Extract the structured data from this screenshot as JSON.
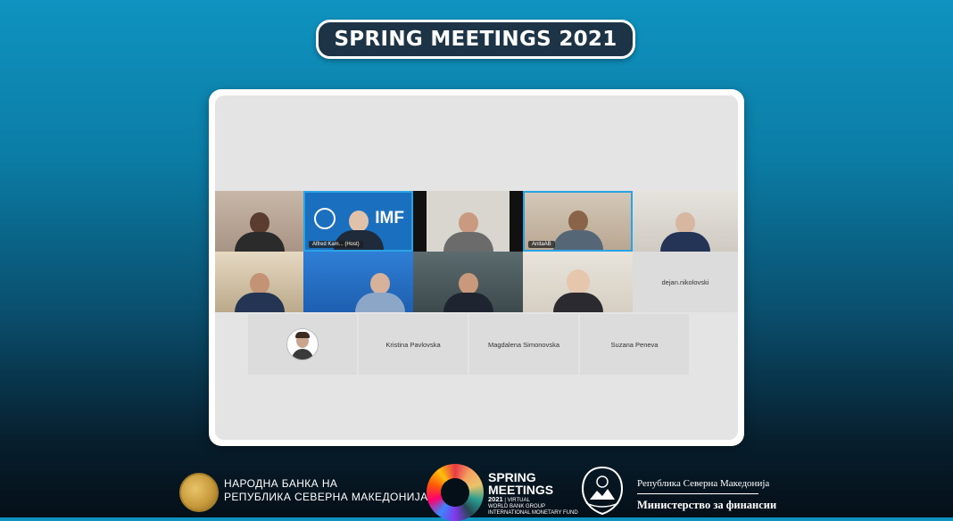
{
  "banner": {
    "title": "SPRING MEETINGS 2021"
  },
  "meeting": {
    "tiles": [
      {
        "id": "p1",
        "label": ""
      },
      {
        "id": "p2",
        "label": "Alfred Kam... (Host)",
        "logo_text": "IMF"
      },
      {
        "id": "p3",
        "label": ""
      },
      {
        "id": "p4",
        "label": "AnitaAB"
      },
      {
        "id": "p5",
        "label": ""
      },
      {
        "id": "p6",
        "label": ""
      },
      {
        "id": "p7",
        "label": ""
      },
      {
        "id": "p8",
        "label": ""
      },
      {
        "id": "p9",
        "label": ""
      },
      {
        "id": "p10",
        "label": "dejan.nikolovski"
      },
      {
        "id": "p11",
        "label": ""
      },
      {
        "id": "p12",
        "label": "Kristina Pavlovska"
      },
      {
        "id": "p13",
        "label": "Magdalena Simonovska"
      },
      {
        "id": "p14",
        "label": "Suzana Peneva"
      }
    ]
  },
  "footer": {
    "nbrsm": {
      "line1": "НАРОДНА БАНКА НА",
      "line2": "РЕПУБЛИКА СЕВЕРНА МАКЕДОНИЈА"
    },
    "spring_meetings": {
      "line1": "SPRING",
      "line2": "MEETINGS",
      "year": "2021",
      "virtual": "VIRTUAL",
      "org1": "WORLD BANK GROUP",
      "org2": "INTERNATIONAL MONETARY FUND"
    },
    "ministry": {
      "line1": "Република Северна Македонија",
      "line2": "Министерство за финансии"
    }
  },
  "colors": {
    "active_border": "#2aa3e4",
    "banner_bg": "#1d3447",
    "imf_blue": "#1a6fbf"
  }
}
